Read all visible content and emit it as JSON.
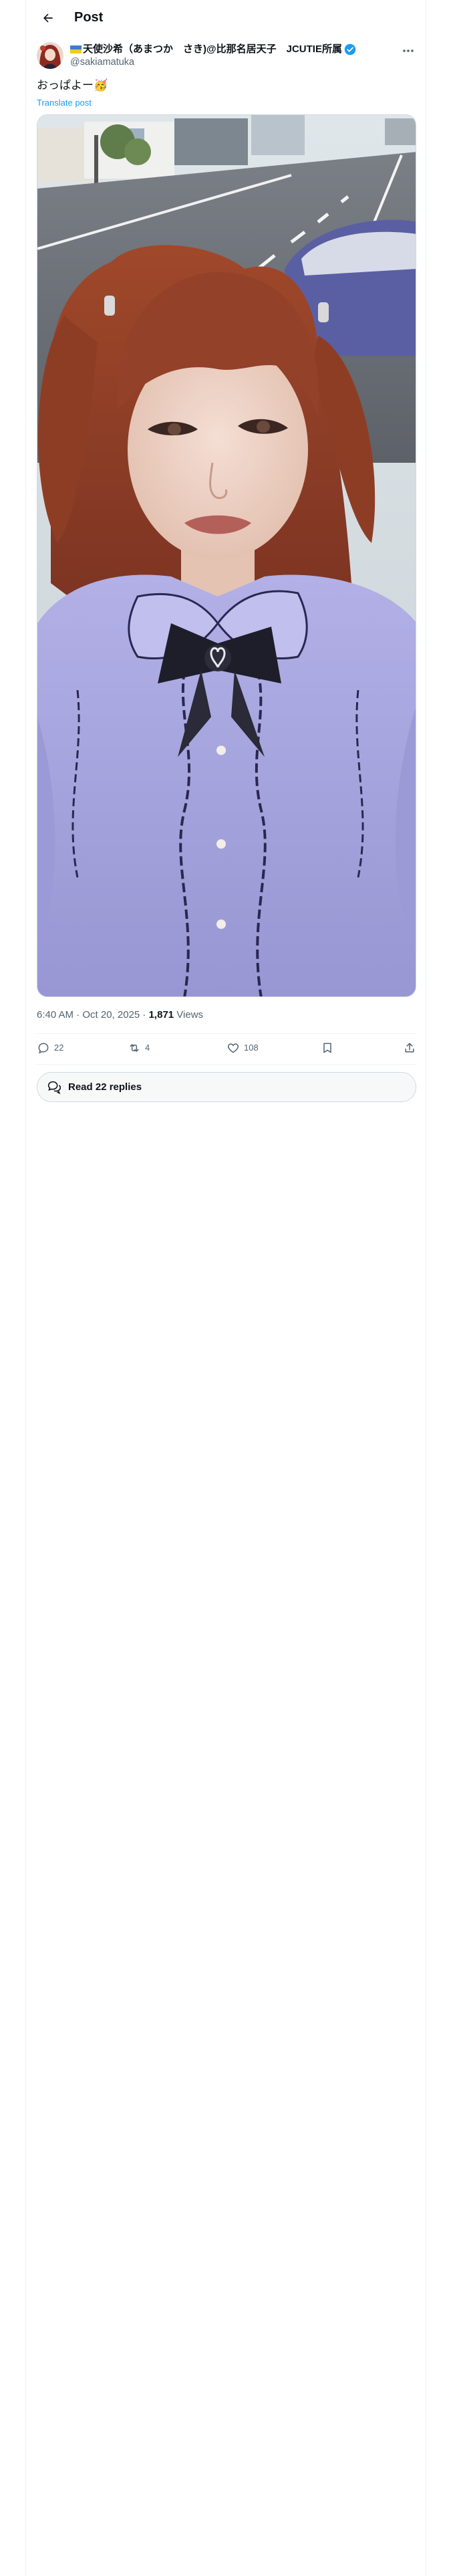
{
  "header": {
    "title": "Post"
  },
  "author": {
    "display_name": "天使沙希（あまつか　さき)@比那名居天子　JCUTIE所属",
    "handle": "@sakiamatuka"
  },
  "post": {
    "text": "おっぱよー🥳",
    "translate_label": "Translate post",
    "time": "6:40 AM · Oct 20, 2025 · ",
    "views_count": "1,871",
    "views_label": " Views"
  },
  "actions": {
    "reply_count": "22",
    "repost_count": "4",
    "like_count": "108"
  },
  "replies_button": {
    "label": "Read 22 replies"
  },
  "colors": {
    "accent": "#1d9bf0",
    "blouse": "#a7a6e0",
    "hair": "#8a3f26"
  }
}
